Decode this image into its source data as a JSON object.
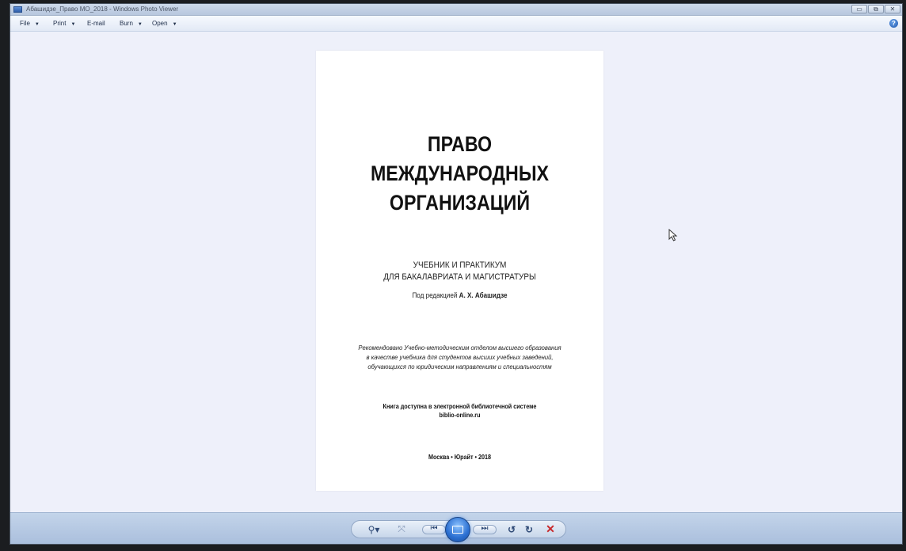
{
  "window": {
    "title": "Абашидзе_Право МО_2018 - Windows Photo Viewer",
    "minimize": "▭",
    "maximize": "⧉",
    "close": "✕"
  },
  "menu": {
    "file": "File",
    "print": "Print",
    "email": "E-mail",
    "burn": "Burn",
    "open": "Open",
    "arrow": "▼",
    "help": "?"
  },
  "document": {
    "title_lines": [
      "ПРАВО",
      "МЕЖДУНАРОДНЫХ",
      "ОРГАНИЗАЦИЙ"
    ],
    "subtitle_lines": [
      "УЧЕБНИК И ПРАКТИКУМ",
      "ДЛЯ БАКАЛАВРИАТА И МАГИСТРАТУРЫ"
    ],
    "editor_prefix": "Под редакцией",
    "editor_name": "А. Х. Абашидзе",
    "recommendation_lines": [
      "Рекомендовано Учебно-методическим отделом высшего образования",
      "в качестве учебника для студентов высших учебных заведений,",
      "обучающихся по юридическим направлениям и специальностям"
    ],
    "availability_lines": [
      "Книга доступна в электронной библиотечной системе",
      "biblio-online.ru"
    ],
    "imprint": "Москва • Юрайт • 2018"
  },
  "toolbar": {
    "zoom": "⚲▾",
    "fit": "⤧",
    "prev": "⏮",
    "next": "⏭",
    "rotate_left": "↺",
    "rotate_right": "↻",
    "delete": "✕"
  },
  "colors": {
    "accent": "#2b6fd1",
    "delete": "#c8282a",
    "background": "#eef0fa"
  }
}
